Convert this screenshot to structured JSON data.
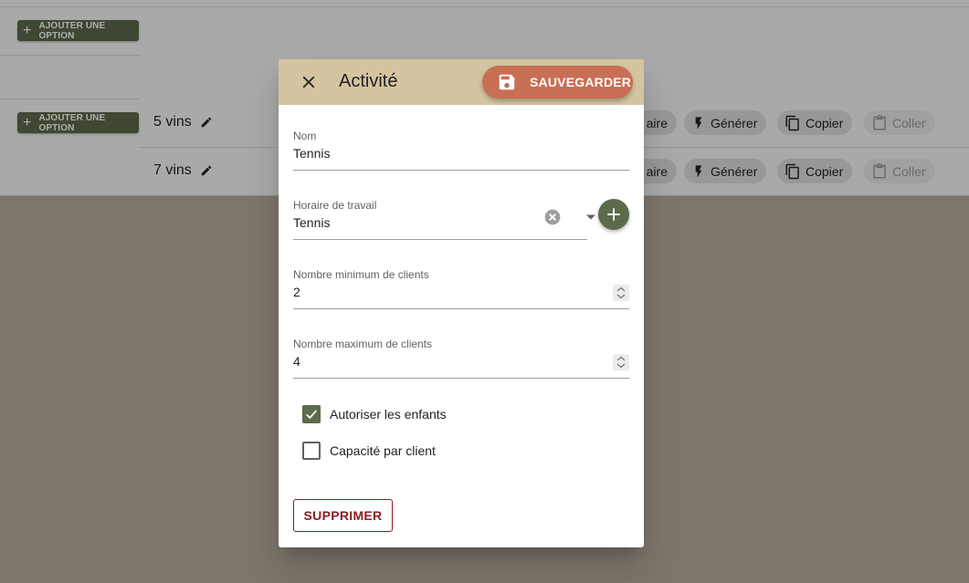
{
  "background": {
    "add_option_label": "AJOUTER UNE OPTION",
    "rows": [
      {
        "title": "5 vins"
      },
      {
        "title": "7 vins"
      }
    ],
    "chips": {
      "horaire_partial": "aire",
      "generate": "Générer",
      "copy": "Copier",
      "paste": "Coller"
    }
  },
  "dialog": {
    "title": "Activité",
    "save_label": "SAUVEGARDER",
    "fields": {
      "name": {
        "label": "Nom",
        "value": "Tennis"
      },
      "schedule": {
        "label": "Horaire de travail",
        "value": "Tennis"
      },
      "min_clients": {
        "label": "Nombre minimum de clients",
        "value": "2"
      },
      "max_clients": {
        "label": "Nombre maximum de clients",
        "value": "4"
      }
    },
    "checkboxes": {
      "allow_children": {
        "label": "Autoriser les enfants",
        "checked": true
      },
      "capacity_per_client": {
        "label": "Capacité par client",
        "checked": false
      }
    },
    "delete_label": "SUPPRIMER"
  },
  "colors": {
    "header_bg": "#d4c4a0",
    "save_bg": "#c96f55",
    "primary_green": "#5c6b4a",
    "danger": "#8b1e24"
  }
}
